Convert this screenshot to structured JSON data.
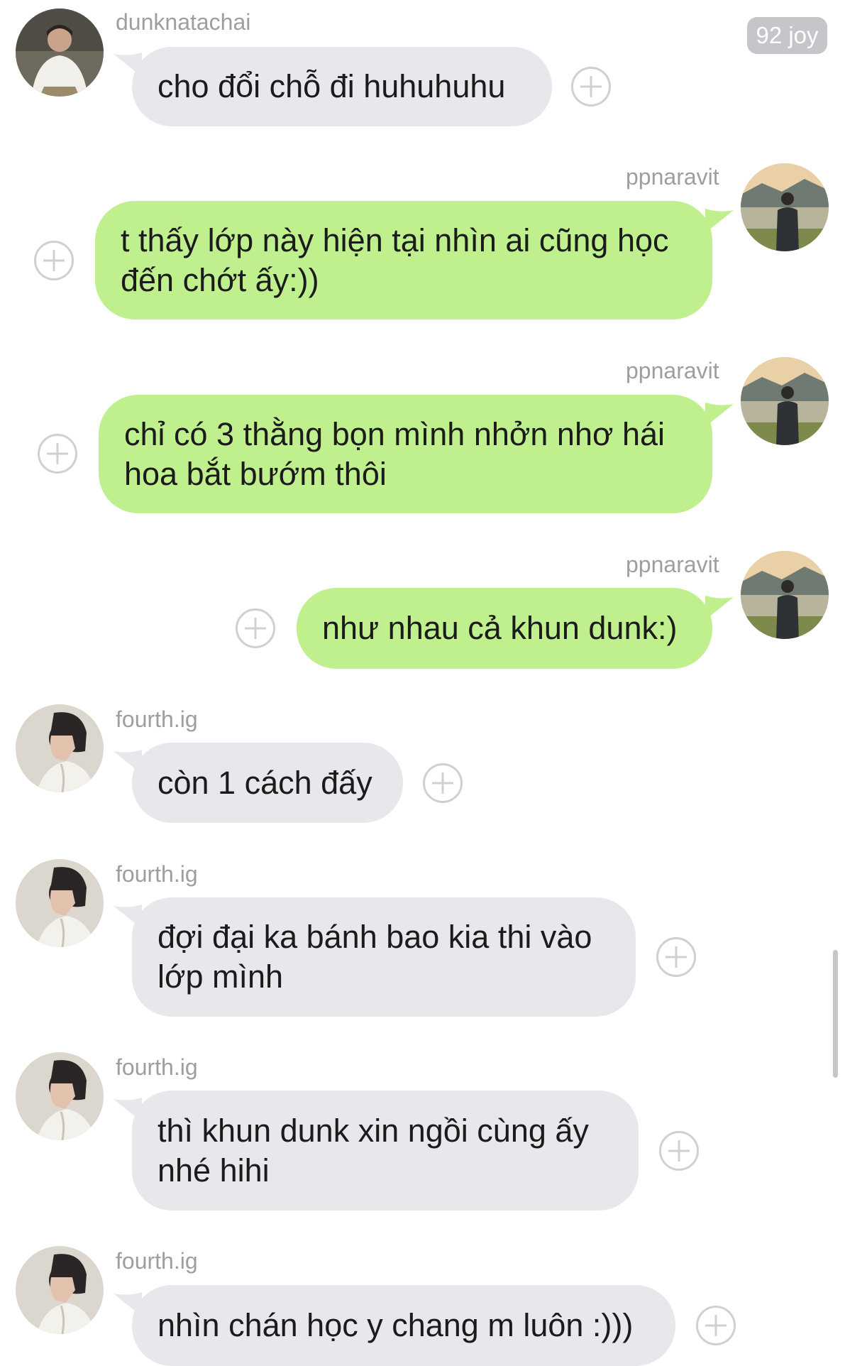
{
  "badge": "92 joy",
  "messages": [
    {
      "user": "dunknatachai",
      "text": "cho đổi chỗ đi huhuhuhu",
      "dir": "in",
      "avatar": "person-white-shirt"
    },
    {
      "user": "ppnaravit",
      "text": "t thấy lớp này hiện tại nhìn ai cũng học\nđến chớt ấy:))",
      "dir": "out",
      "avatar": "person-lake-landscape"
    },
    {
      "user": "ppnaravit",
      "text": "chỉ có 3 thằng bọn mình nhởn nhơ hái\nhoa bắt bướm thôi",
      "dir": "out",
      "avatar": "person-lake-landscape"
    },
    {
      "user": "ppnaravit",
      "text": "như nhau cả khun dunk:)",
      "dir": "out",
      "avatar": "person-lake-landscape"
    },
    {
      "user": "fourth.ig",
      "text": "còn 1 cách đấy",
      "dir": "in",
      "avatar": "person-profile-hoodie"
    },
    {
      "user": "fourth.ig",
      "text": "đợi đại ka bánh bao kia thi vào\nlớp mình",
      "dir": "in",
      "avatar": "person-profile-hoodie"
    },
    {
      "user": "fourth.ig",
      "text": "thì khun dunk xin ngồi cùng ấy\nnhé hihi",
      "dir": "in",
      "avatar": "person-profile-hoodie"
    },
    {
      "user": "fourth.ig",
      "text": "nhìn chán học y chang m luôn :)))",
      "dir": "in",
      "avatar": "person-profile-hoodie"
    }
  ],
  "colors": {
    "incoming_bubble": "#e6e8eb",
    "outgoing_bubble": "#c0f08e",
    "username": "#9c9ea2",
    "badge_bg": "#c4c6c9"
  }
}
